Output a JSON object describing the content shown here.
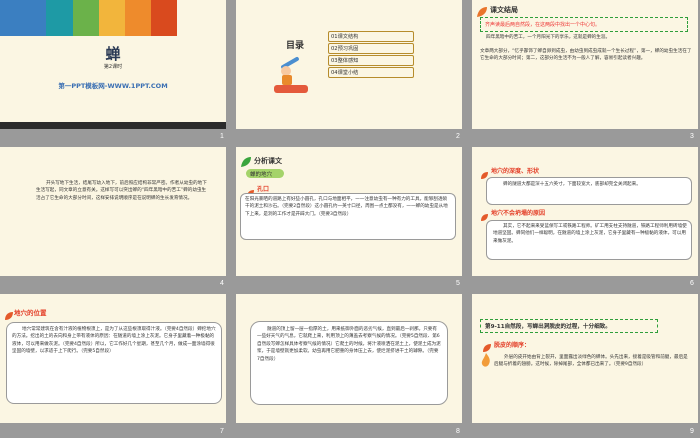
{
  "slides": [
    {
      "num": "1",
      "title": "蝉",
      "subtitle": "第2课时",
      "brand": "第一PPT模板网-WWW.1PPT.COM",
      "bars": [
        "#3b7fc1",
        "#1e9aa5",
        "#6bb24a",
        "#f2b53c",
        "#ee8b2c",
        "#d94a1e"
      ]
    },
    {
      "num": "2",
      "heading": "目录",
      "items": [
        "01课文结构",
        "02预习巩固",
        "03整体感知",
        "04课堂小结"
      ]
    },
    {
      "num": "3",
      "title": "课文结局",
      "question": "齐声读最后两自然段，在这两段中找出一个中心句。",
      "para1": "四年黑暗中的苦工，一个月阳光下的享乐，这就是蝉的生涯。",
      "para2": "文章两大部分，“忆乎鄙饰了蝉自卵到成虫，由幼虫到成虫成就一个生长过程”，第一，蝉的幼虫生活在了它生命的大部分时间；第二，这部分的生活不为一般人了解，容易引起读者兴趣。"
    },
    {
      "num": "4",
      "para": "开头写地下生活，结尾写幼入地下，前后照应结构非常严密。作者从幼虫的地下生活写起，同文章的立意有关。这样写可以突出蝉的“四年黑暗中的苦工”蝉的幼虫生活占了它生命的大部分时间，这样安排说明顺序是在说明蝉的生长发育情况。"
    },
    {
      "num": "5",
      "title": "分析课文",
      "tag": "蝉的地穴",
      "subtitle": "孔口",
      "para": "在阳光暴晒的道路上有好些小圆孔，孔口与地面相平，一一注意幼虫有一种有力的工具，能够刮透硕干的泥土和沙石。（完要2自然段）这小圆孔约一英寸口径，周围一点土都没有，一一蝉的幼虫是从地下上来，是洞的工作才是开辟大门。（完要3自然段）"
    },
    {
      "num": "6",
      "heading1": "地穴的深度、形状",
      "para1": "蝉的隧道大都是深十五六英寸，下面较宽大，底部却完全关闭起来。",
      "heading2": "地穴不会坍塌的原因",
      "para2": "其实，它不起来来受蓝保写工或铁路工程师。矿工用支柱支持隧道，铁路工程师利用砖墙使地道坚固。蝉同他们一样聪明，在隧道的墙上涂上灰泥，它身子里藏有一种极黏的液体，可以用来做灰泥。"
    },
    {
      "num": "7",
      "title": "地穴的位置",
      "para": "地穴常常建筑在含有汁液的植物根须上，是为了从这些根须取得汁液。（完要4自然段）蝉挖地穴的方法。挖出的土的去向和身上带有液体的原因：在隧道的墙上涂上灰泥。它身子里藏着一种极黏的液体，可以用来做灰泥。（完要4自然段）所以，它工作好几个星期，甚至几个月，做成一面涂墙得很坚固的墙壁，以求适于上下爬行。（完要5自然段）"
    },
    {
      "num": "8",
      "para": "隧道的顶上留一层一指厚的土，用来抵御外面的恶劣气候，直到最后一刹那。只要有一些好天气的气息，它就爬上来，利用顶上的薄盖去考察气候的情况。（完要5自然段、第6自然段写蝉怎样具体考察气候的情况）它爬土的时候，将汁液喷洒在泥土上，使泥土成为泥浆，于是墙壁就更加柔软。幼虫再用它肥重的身体压上去，使烂泥挤进干土的罅隙。（完要7自然段）"
    },
    {
      "num": "9",
      "title": "第9-11自然段，写蝉出洞脱皮的过程，十分细致。",
      "subtitle": "脱皮的顺序：",
      "para": "外层的皮开始由背上裂开，里面露出淡绿色的蝉体。头先出来，接着是吸管和前腿，最后是后腿与折着的翅膀。这时候，除掉尾部，全体都已出来了。（完要9自然段）"
    }
  ]
}
